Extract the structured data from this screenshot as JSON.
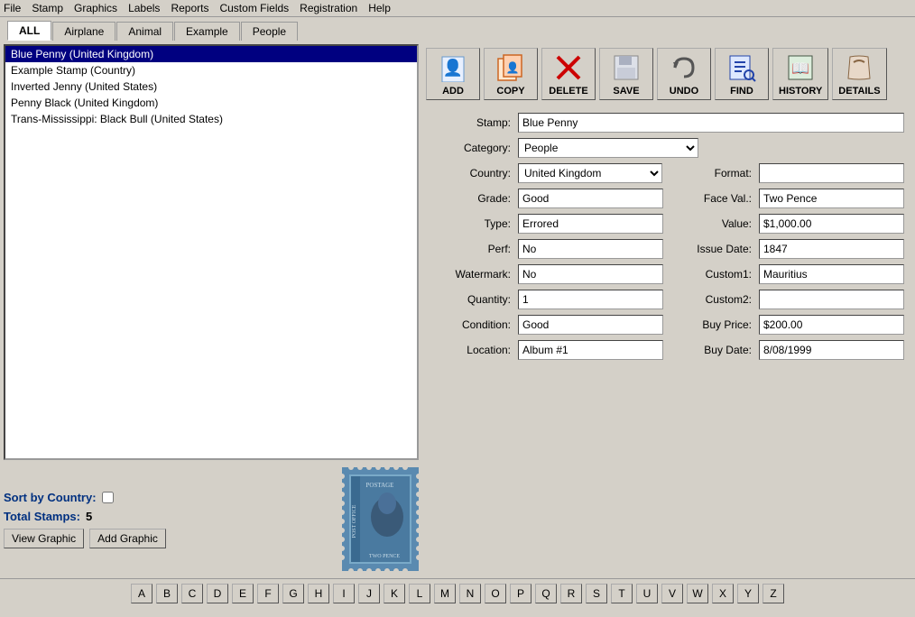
{
  "menubar": {
    "items": [
      "File",
      "Stamp",
      "Graphics",
      "Labels",
      "Reports",
      "Custom Fields",
      "Registration",
      "Help"
    ]
  },
  "tabs": {
    "items": [
      "ALL",
      "Airplane",
      "Animal",
      "Example",
      "People"
    ],
    "active": "ALL"
  },
  "list": {
    "items": [
      "Blue Penny (United Kingdom)",
      "Example Stamp (Country)",
      "Inverted Jenny (United States)",
      "Penny Black (United Kingdom)",
      "Trans-Mississippi: Black Bull (United States)"
    ],
    "selected": 0
  },
  "sort_by_country": {
    "label": "Sort by Country:",
    "checked": false
  },
  "total_stamps": {
    "label": "Total Stamps:",
    "value": "5"
  },
  "buttons": {
    "view_graphic": "View Graphic",
    "add_graphic": "Add Graphic"
  },
  "toolbar": {
    "add": "ADD",
    "copy": "COPY",
    "delete": "DELETE",
    "save": "SAVE",
    "undo": "UNDO",
    "find": "FIND",
    "history": "HISTORY",
    "details": "DETAILS"
  },
  "form": {
    "stamp_label": "Stamp:",
    "stamp_value": "Blue Penny",
    "category_label": "Category:",
    "category_value": "People",
    "country_label": "Country:",
    "country_value": "United Kingdom",
    "format_label": "Format:",
    "format_value": "",
    "grade_label": "Grade:",
    "grade_value": "Good",
    "face_val_label": "Face Val.:",
    "face_val_value": "Two Pence",
    "type_label": "Type:",
    "type_value": "Errored",
    "value_label": "Value:",
    "value_value": "$1,000.00",
    "perf_label": "Perf:",
    "perf_value": "No",
    "issue_date_label": "Issue Date:",
    "issue_date_value": "1847",
    "watermark_label": "Watermark:",
    "watermark_value": "No",
    "custom1_label": "Custom1:",
    "custom1_value": "Mauritius",
    "quantity_label": "Quantity:",
    "quantity_value": "1",
    "custom2_label": "Custom2:",
    "custom2_value": "",
    "condition_label": "Condition:",
    "condition_value": "Good",
    "buy_price_label": "Buy Price:",
    "buy_price_value": "$200.00",
    "location_label": "Location:",
    "location_value": "Album #1",
    "buy_date_label": "Buy Date:",
    "buy_date_value": "8/08/1999"
  },
  "alpha": [
    "A",
    "B",
    "C",
    "D",
    "E",
    "F",
    "G",
    "H",
    "I",
    "J",
    "K",
    "L",
    "M",
    "N",
    "O",
    "P",
    "Q",
    "R",
    "S",
    "T",
    "U",
    "V",
    "W",
    "X",
    "Y",
    "Z"
  ]
}
